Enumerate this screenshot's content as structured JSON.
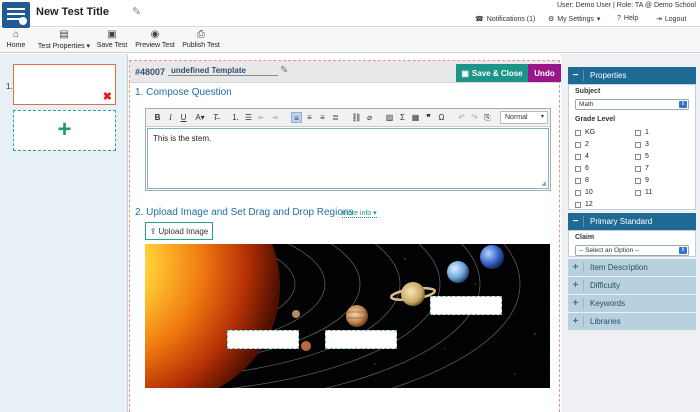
{
  "header": {
    "title": "New Test Title",
    "user_info": "User: Demo User | Role: TA @ Demo School",
    "notifications": "Notifications (1)",
    "my_settings": "My Settings",
    "help": "Help",
    "logout": "Logout"
  },
  "toolbar": {
    "home": "Home",
    "test_properties": "Test Properties",
    "save_test": "Save Test",
    "preview_test": "Preview Test",
    "publish_test": "Publish Test"
  },
  "slides": {
    "number": "1."
  },
  "editor": {
    "item_id": "#48007",
    "template_name": "undefined Template",
    "save_close": "Save & Close",
    "undo": "Undo",
    "section1": "1. Compose Question",
    "format_value": "Normal",
    "stem": "This is the stem.",
    "section2": "2. Upload Image and Set Drag and Drop Regions",
    "more_info": "more info",
    "upload_image": "Upload Image"
  },
  "properties": {
    "header": "Properties",
    "subject_label": "Subject",
    "subject_value": "Math",
    "grade_label": "Grade Level",
    "grades_left": [
      "KG",
      "2",
      "4",
      "6",
      "8",
      "10",
      "12"
    ],
    "grades_right": [
      "1",
      "3",
      "5",
      "7",
      "9",
      "11"
    ]
  },
  "primary_standard": {
    "header": "Primary Standard",
    "claim_label": "Claim",
    "claim_value": "-- Select an Option --"
  },
  "collapsed_sections": [
    "Item Description",
    "Difficulty",
    "Keywords",
    "Libraries"
  ],
  "colors": {
    "brand_blue": "#1f5a95",
    "teal": "#1c9487",
    "purple": "#98168a",
    "delete_red": "#e01e1e"
  }
}
